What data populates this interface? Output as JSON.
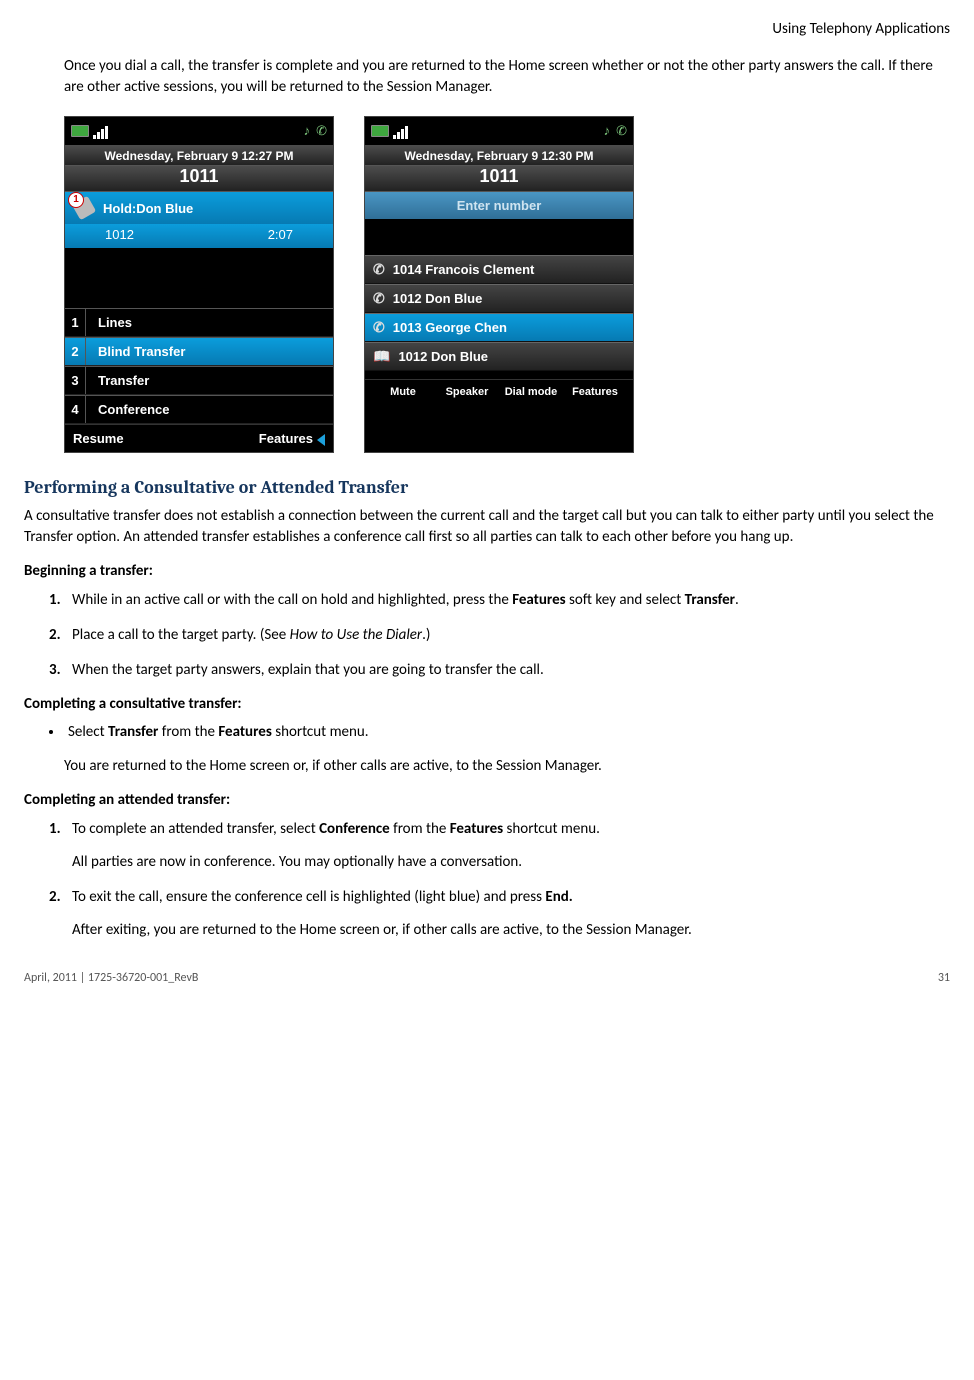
{
  "header": {
    "title": "Using Telephony Applications"
  },
  "intro": "Once you dial a call, the transfer is complete and you are returned to the Home screen whether or not the other party answers the call. If there are other active sessions, you will be returned to the Session Manager.",
  "screens": {
    "left": {
      "date": "Wednesday, February 9 12:27 PM",
      "ext": "1011",
      "hold_label": "Hold:Don Blue",
      "hold_sub_left": "1012",
      "hold_sub_right": "2:07",
      "menu": [
        {
          "num": "1",
          "label": "Lines",
          "selected": false
        },
        {
          "num": "2",
          "label": "Blind Transfer",
          "selected": true
        },
        {
          "num": "3",
          "label": "Transfer",
          "selected": false
        },
        {
          "num": "4",
          "label": "Conference",
          "selected": false
        }
      ],
      "softkeys": {
        "left": "Resume",
        "right": "Features"
      }
    },
    "right": {
      "date": "Wednesday, February 9 12:30 PM",
      "ext": "1011",
      "enter": "Enter number",
      "contacts": [
        {
          "icon": "phone",
          "label": "1014 Francois Clement",
          "selected": false
        },
        {
          "icon": "phone",
          "label": "1012 Don Blue",
          "selected": false
        },
        {
          "icon": "phone",
          "label": "1013 George Chen",
          "selected": true
        },
        {
          "icon": "book",
          "label": "1012 Don Blue",
          "selected": false
        }
      ],
      "softkeys4": [
        "Mute",
        "Speaker",
        "Dial mode",
        "Features"
      ]
    }
  },
  "section_title": "Performing a Consultative or Attended Transfer",
  "section_para": "A consultative transfer does not establish a connection between the current call and the target call but you can talk to either party until you select the Transfer option. An attended transfer establishes a conference call first so all parties can talk to each other before you hang up.",
  "begin_head": "Beginning a transfer:",
  "begin_steps": {
    "s1_a": "While in an active call or with the call on hold and highlighted, press the ",
    "s1_b": "Features",
    "s1_c": " soft key and select ",
    "s1_d": "Transfer",
    "s1_e": ".",
    "s2_a": "Place a call to the target party. (See ",
    "s2_b": "How to Use the Dialer",
    "s2_c": ".)",
    "s3": "When the target party answers, explain that you are going to transfer the call."
  },
  "consult_head": "Completing a consultative transfer:",
  "consult": {
    "bullet_a": "Select ",
    "bullet_b": "Transfer",
    "bullet_c": " from the ",
    "bullet_d": "Features",
    "bullet_e": " shortcut menu.",
    "after": "You are returned to the Home screen or, if other calls are active, to the Session Manager."
  },
  "attended_head": "Completing an attended transfer:",
  "attended": {
    "s1_a": "To complete an attended transfer, select ",
    "s1_b": "Conference",
    "s1_c": " from the ",
    "s1_d": "Features",
    "s1_e": " shortcut menu.",
    "s1_sub": "All parties are now in conference. You may optionally have a conversation.",
    "s2_a": "To exit the call, ensure the conference cell is highlighted (light blue) and press ",
    "s2_b": "End.",
    "s2_sub": "After exiting, you are returned to the Home screen or, if other calls are active, to the Session Manager."
  },
  "footer": {
    "left": "April, 2011  |  1725-36720-001_RevB",
    "right": "31"
  }
}
